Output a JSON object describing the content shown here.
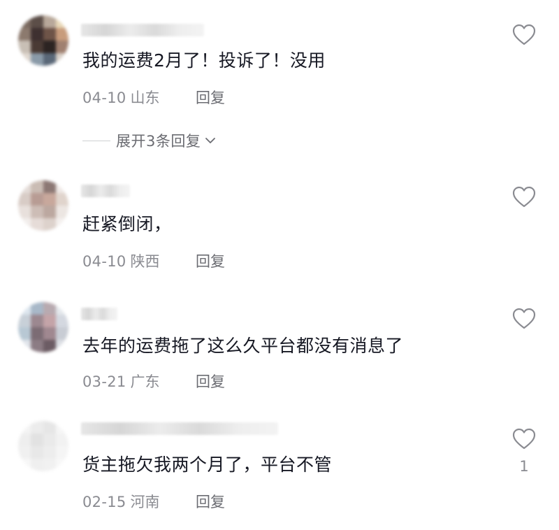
{
  "comments": [
    {
      "text": "我的运费2月了！投诉了！没用",
      "date": "04-10",
      "location": "山东",
      "reply_label": "回复",
      "like_count": "",
      "expand_label": "展开3条回复"
    },
    {
      "text": "赶紧倒闭，",
      "date": "04-10",
      "location": "陕西",
      "reply_label": "回复",
      "like_count": ""
    },
    {
      "text": "去年的运费拖了这么久平台都没有消息了",
      "date": "03-21",
      "location": "广东",
      "reply_label": "回复",
      "like_count": ""
    },
    {
      "text": "货主拖欠我两个月了，平台不管",
      "date": "02-15",
      "location": "河南",
      "reply_label": "回复",
      "like_count": "1"
    }
  ],
  "colors": {
    "primary_text": "#161823",
    "secondary_text": "#8a8b91",
    "reply_text": "#6b6c72",
    "icon_stroke": "#8a8b91"
  },
  "icons": {
    "like": "heart-outline-icon",
    "expand": "chevron-down-icon"
  }
}
